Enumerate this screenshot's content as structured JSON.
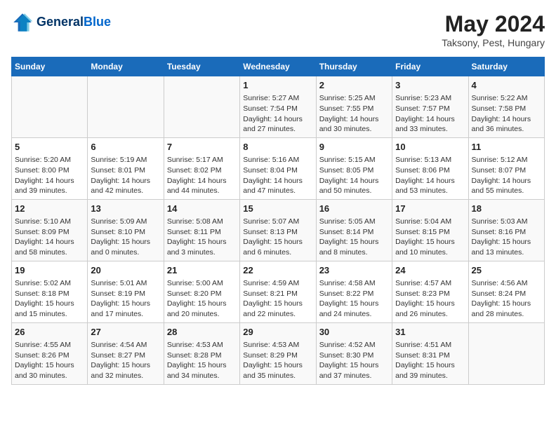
{
  "header": {
    "logo_line1": "General",
    "logo_line2": "Blue",
    "title": "May 2024",
    "subtitle": "Taksony, Pest, Hungary"
  },
  "days_of_week": [
    "Sunday",
    "Monday",
    "Tuesday",
    "Wednesday",
    "Thursday",
    "Friday",
    "Saturday"
  ],
  "weeks": [
    [
      {
        "day": "",
        "info": ""
      },
      {
        "day": "",
        "info": ""
      },
      {
        "day": "",
        "info": ""
      },
      {
        "day": "1",
        "info": "Sunrise: 5:27 AM\nSunset: 7:54 PM\nDaylight: 14 hours and 27 minutes."
      },
      {
        "day": "2",
        "info": "Sunrise: 5:25 AM\nSunset: 7:55 PM\nDaylight: 14 hours and 30 minutes."
      },
      {
        "day": "3",
        "info": "Sunrise: 5:23 AM\nSunset: 7:57 PM\nDaylight: 14 hours and 33 minutes."
      },
      {
        "day": "4",
        "info": "Sunrise: 5:22 AM\nSunset: 7:58 PM\nDaylight: 14 hours and 36 minutes."
      }
    ],
    [
      {
        "day": "5",
        "info": "Sunrise: 5:20 AM\nSunset: 8:00 PM\nDaylight: 14 hours and 39 minutes."
      },
      {
        "day": "6",
        "info": "Sunrise: 5:19 AM\nSunset: 8:01 PM\nDaylight: 14 hours and 42 minutes."
      },
      {
        "day": "7",
        "info": "Sunrise: 5:17 AM\nSunset: 8:02 PM\nDaylight: 14 hours and 44 minutes."
      },
      {
        "day": "8",
        "info": "Sunrise: 5:16 AM\nSunset: 8:04 PM\nDaylight: 14 hours and 47 minutes."
      },
      {
        "day": "9",
        "info": "Sunrise: 5:15 AM\nSunset: 8:05 PM\nDaylight: 14 hours and 50 minutes."
      },
      {
        "day": "10",
        "info": "Sunrise: 5:13 AM\nSunset: 8:06 PM\nDaylight: 14 hours and 53 minutes."
      },
      {
        "day": "11",
        "info": "Sunrise: 5:12 AM\nSunset: 8:07 PM\nDaylight: 14 hours and 55 minutes."
      }
    ],
    [
      {
        "day": "12",
        "info": "Sunrise: 5:10 AM\nSunset: 8:09 PM\nDaylight: 14 hours and 58 minutes."
      },
      {
        "day": "13",
        "info": "Sunrise: 5:09 AM\nSunset: 8:10 PM\nDaylight: 15 hours and 0 minutes."
      },
      {
        "day": "14",
        "info": "Sunrise: 5:08 AM\nSunset: 8:11 PM\nDaylight: 15 hours and 3 minutes."
      },
      {
        "day": "15",
        "info": "Sunrise: 5:07 AM\nSunset: 8:13 PM\nDaylight: 15 hours and 6 minutes."
      },
      {
        "day": "16",
        "info": "Sunrise: 5:05 AM\nSunset: 8:14 PM\nDaylight: 15 hours and 8 minutes."
      },
      {
        "day": "17",
        "info": "Sunrise: 5:04 AM\nSunset: 8:15 PM\nDaylight: 15 hours and 10 minutes."
      },
      {
        "day": "18",
        "info": "Sunrise: 5:03 AM\nSunset: 8:16 PM\nDaylight: 15 hours and 13 minutes."
      }
    ],
    [
      {
        "day": "19",
        "info": "Sunrise: 5:02 AM\nSunset: 8:18 PM\nDaylight: 15 hours and 15 minutes."
      },
      {
        "day": "20",
        "info": "Sunrise: 5:01 AM\nSunset: 8:19 PM\nDaylight: 15 hours and 17 minutes."
      },
      {
        "day": "21",
        "info": "Sunrise: 5:00 AM\nSunset: 8:20 PM\nDaylight: 15 hours and 20 minutes."
      },
      {
        "day": "22",
        "info": "Sunrise: 4:59 AM\nSunset: 8:21 PM\nDaylight: 15 hours and 22 minutes."
      },
      {
        "day": "23",
        "info": "Sunrise: 4:58 AM\nSunset: 8:22 PM\nDaylight: 15 hours and 24 minutes."
      },
      {
        "day": "24",
        "info": "Sunrise: 4:57 AM\nSunset: 8:23 PM\nDaylight: 15 hours and 26 minutes."
      },
      {
        "day": "25",
        "info": "Sunrise: 4:56 AM\nSunset: 8:24 PM\nDaylight: 15 hours and 28 minutes."
      }
    ],
    [
      {
        "day": "26",
        "info": "Sunrise: 4:55 AM\nSunset: 8:26 PM\nDaylight: 15 hours and 30 minutes."
      },
      {
        "day": "27",
        "info": "Sunrise: 4:54 AM\nSunset: 8:27 PM\nDaylight: 15 hours and 32 minutes."
      },
      {
        "day": "28",
        "info": "Sunrise: 4:53 AM\nSunset: 8:28 PM\nDaylight: 15 hours and 34 minutes."
      },
      {
        "day": "29",
        "info": "Sunrise: 4:53 AM\nSunset: 8:29 PM\nDaylight: 15 hours and 35 minutes."
      },
      {
        "day": "30",
        "info": "Sunrise: 4:52 AM\nSunset: 8:30 PM\nDaylight: 15 hours and 37 minutes."
      },
      {
        "day": "31",
        "info": "Sunrise: 4:51 AM\nSunset: 8:31 PM\nDaylight: 15 hours and 39 minutes."
      },
      {
        "day": "",
        "info": ""
      }
    ]
  ]
}
